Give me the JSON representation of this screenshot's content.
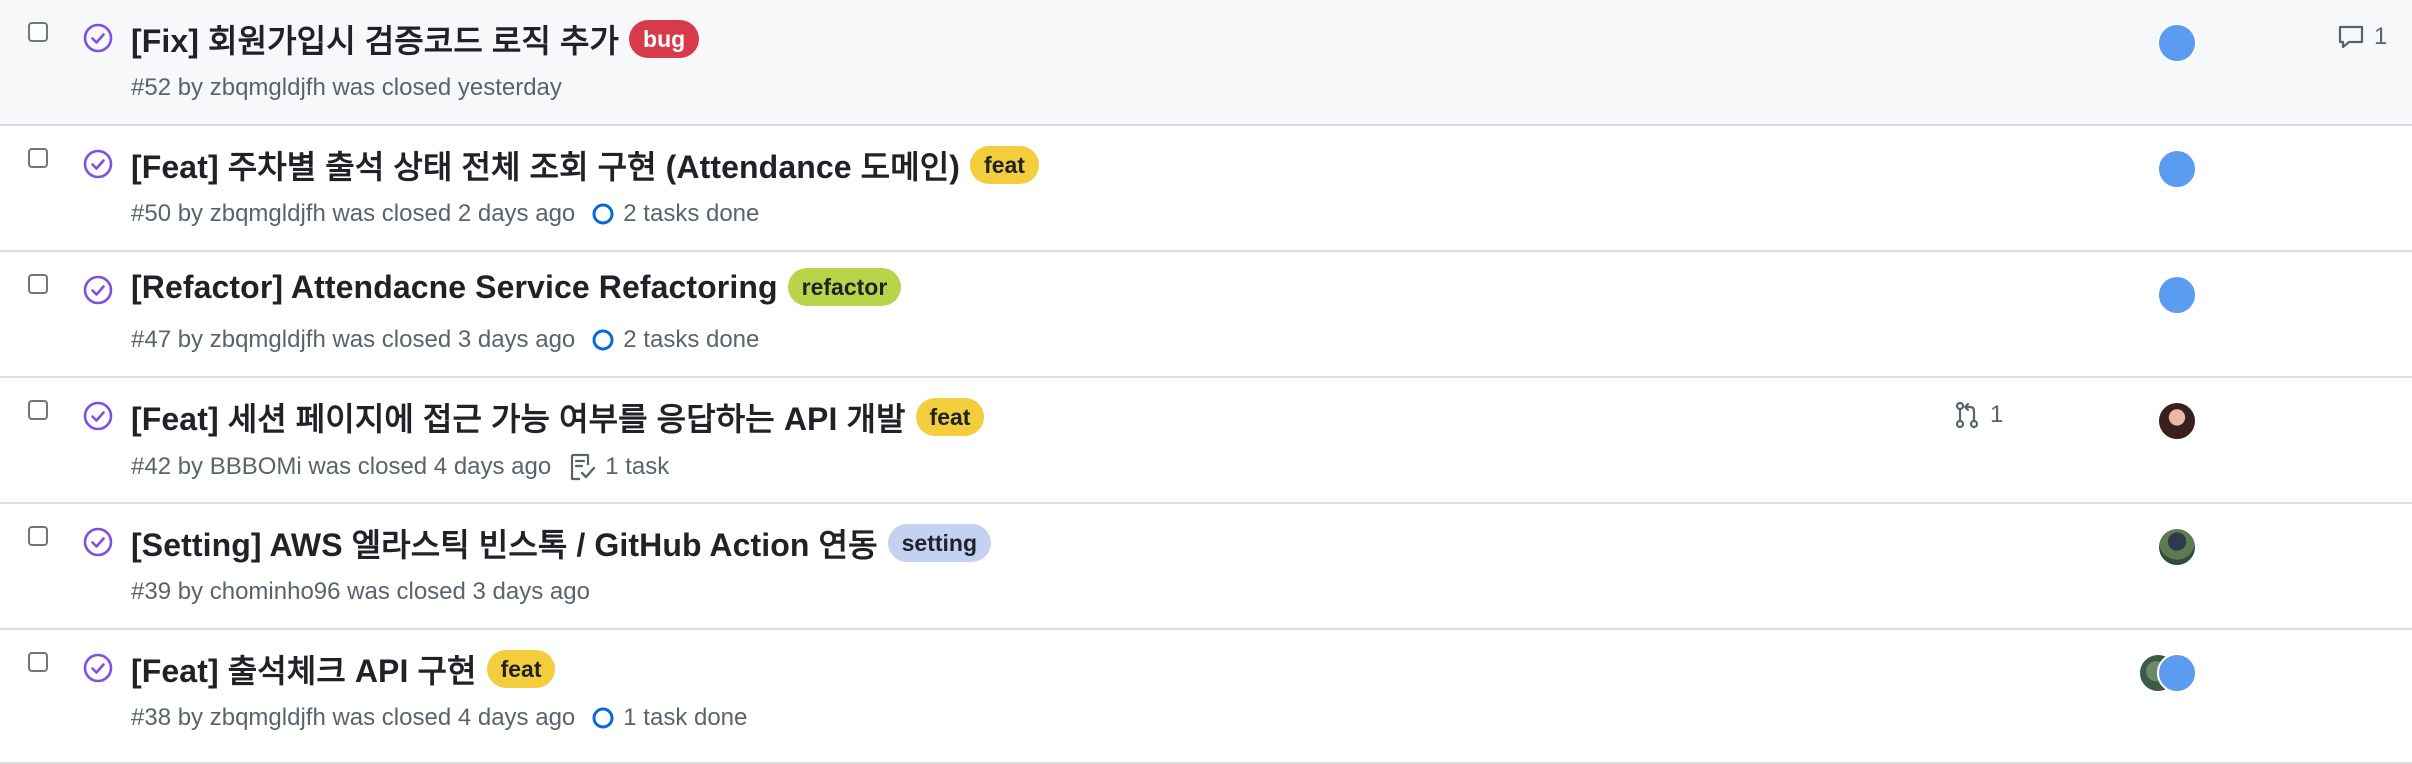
{
  "issues": [
    {
      "title": "[Fix] 회원가입시 검증코드 로직 추가",
      "label": "bug",
      "meta": "#52 by zbqmgldjfh was closed yesterday",
      "tasks": "",
      "comments": "1",
      "linked_prs": ""
    },
    {
      "title": "[Feat] 주차별 출석 상태 전체 조회 구현 (Attendance 도메인)",
      "label": "feat",
      "meta": "#50 by zbqmgldjfh was closed 2 days ago",
      "tasks": "2 tasks done",
      "comments": "",
      "linked_prs": ""
    },
    {
      "title": "[Refactor] Attendacne Service Refactoring",
      "label": "refactor",
      "meta": "#47 by zbqmgldjfh was closed 3 days ago",
      "tasks": "2 tasks done",
      "comments": "",
      "linked_prs": ""
    },
    {
      "title": "[Feat] 세션 페이지에 접근 가능 여부를 응답하는 API 개발",
      "label": "feat",
      "meta": "#42 by BBBOMi was closed 4 days ago",
      "tasks": "1 task",
      "comments": "",
      "linked_prs": "1"
    },
    {
      "title": "[Setting] AWS 엘라스틱 빈스톡 / GitHub Action 연동",
      "label": "setting",
      "meta": "#39 by chominho96 was closed 3 days ago",
      "tasks": "",
      "comments": "",
      "linked_prs": ""
    },
    {
      "title": "[Feat] 출석체크 API 구현",
      "label": "feat",
      "meta": "#38 by zbqmgldjfh was closed 4 days ago",
      "tasks": "1 task done",
      "comments": "",
      "linked_prs": ""
    }
  ],
  "colors": {
    "closed_icon": "#8250df",
    "task_progress": "#0969da",
    "label_bug": "#d73a4a",
    "label_feat": "#f3cd3c",
    "label_refactor": "#b8d449",
    "label_setting": "#c5d1f0",
    "avatar_blue": "#5b9bf0"
  },
  "icons": {
    "state": "issue-closed-icon",
    "comment": "comment-icon",
    "task_progress": "task-progress-circle-icon",
    "task_list": "checklist-icon",
    "linked_pr": "git-pull-request-icon"
  }
}
